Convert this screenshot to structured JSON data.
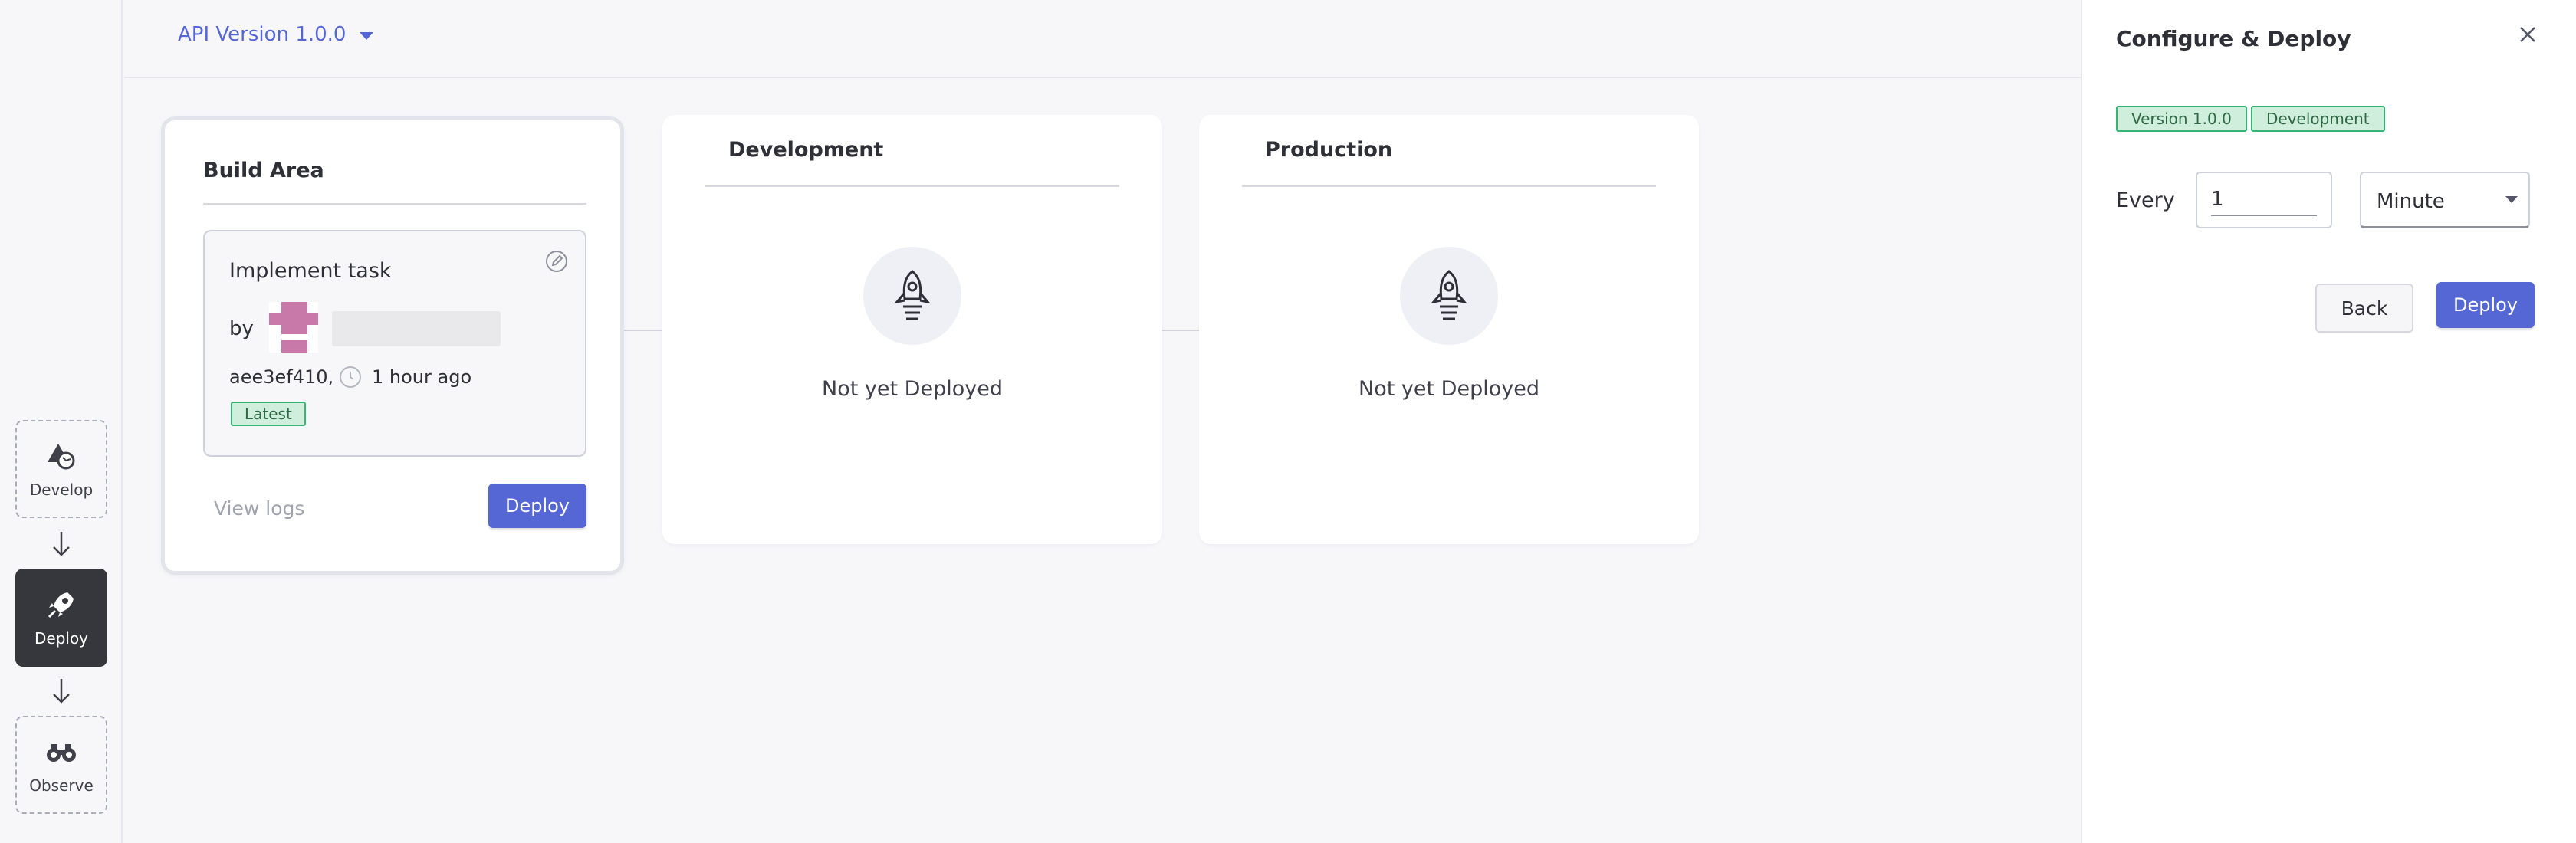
{
  "header": {
    "api_version": "API Version 1.0.0"
  },
  "sidebar": {
    "steps": [
      {
        "label": "Develop",
        "active": false
      },
      {
        "label": "Deploy",
        "active": true
      },
      {
        "label": "Observe",
        "active": false
      }
    ]
  },
  "build_area": {
    "title": "Build Area",
    "commit": {
      "title": "Implement task",
      "by_label": "by",
      "hash": "aee3ef410,",
      "time": "1 hour ago",
      "badge": "Latest"
    },
    "view_logs": "View logs",
    "deploy_label": "Deploy"
  },
  "environments": [
    {
      "title": "Development",
      "status": "Not yet Deployed"
    },
    {
      "title": "Production",
      "status": "Not yet Deployed"
    }
  ],
  "panel": {
    "title": "Configure & Deploy",
    "tags": [
      "Version 1.0.0",
      "Development"
    ],
    "every_label": "Every",
    "interval_value": "1",
    "unit": "Minute",
    "back_label": "Back",
    "deploy_label": "Deploy"
  },
  "colors": {
    "accent": "#5567d5",
    "badge_bg": "#cfeedb",
    "badge_border": "#36b475",
    "avatar": "#c978aa",
    "active_step": "#36363d"
  }
}
